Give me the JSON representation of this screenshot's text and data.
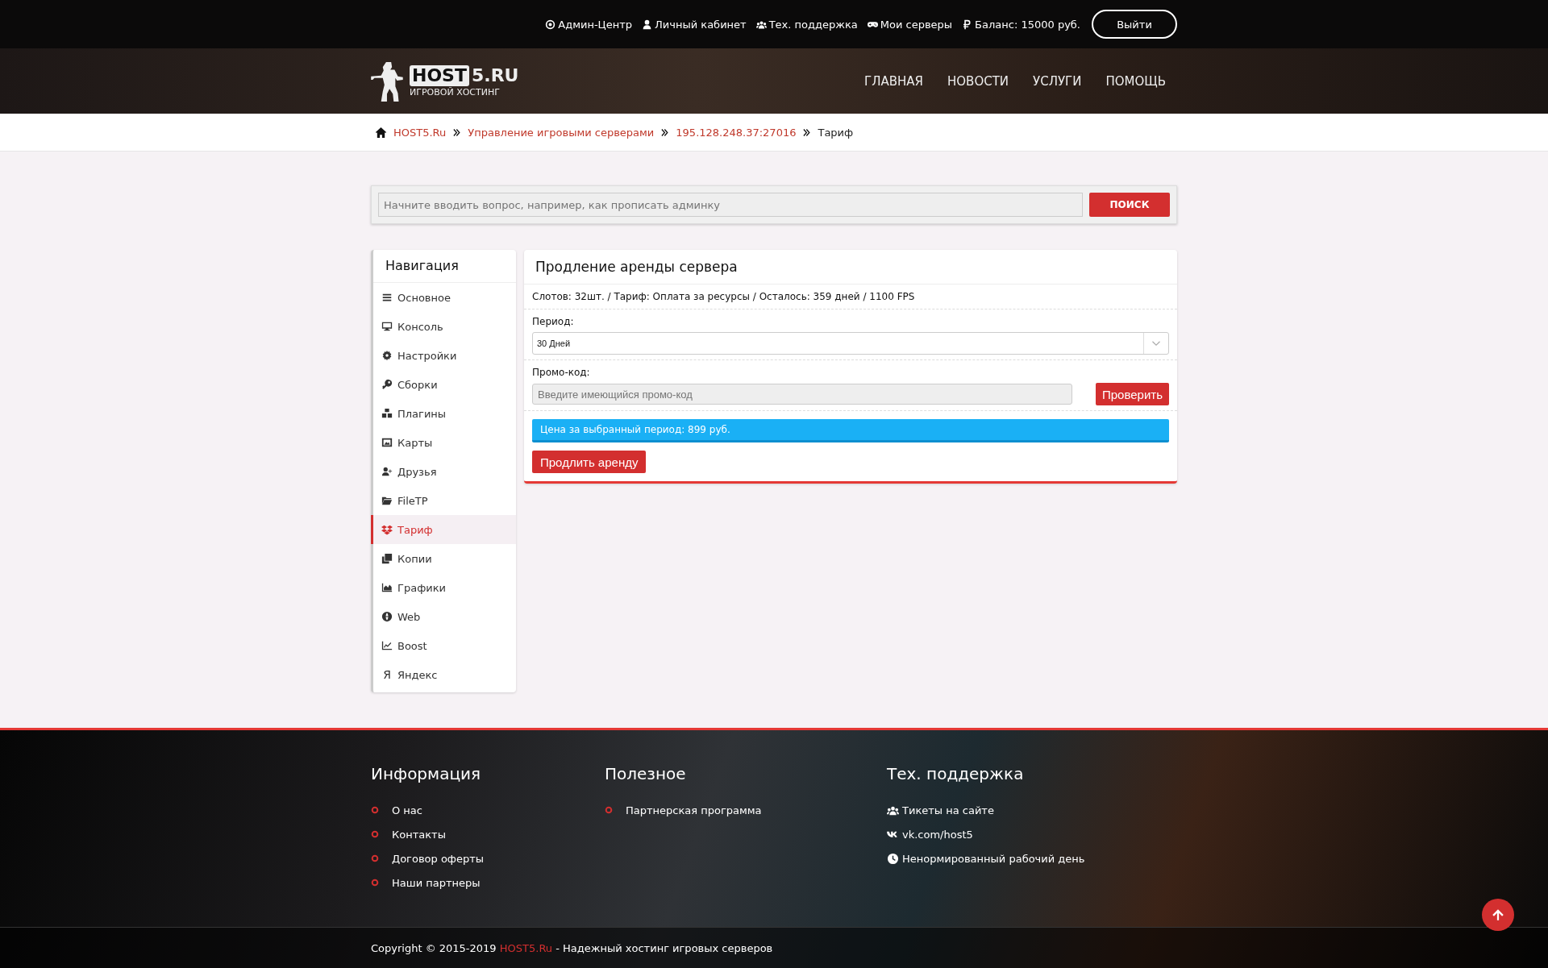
{
  "top_bar": {
    "links": [
      {
        "label": "Админ-Центр"
      },
      {
        "label": "Личный кабинет"
      },
      {
        "label": "Тех. поддержка"
      },
      {
        "label": "Мои серверы"
      },
      {
        "label": "Баланс: 15000 руб."
      }
    ],
    "logout": "Выйти"
  },
  "header": {
    "logo": {
      "boxed": "HOST",
      "rest": "5.RU",
      "tagline": "ИГРОВОЙ ХОСТИНГ"
    },
    "nav": [
      "ГЛАВНАЯ",
      "НОВОСТИ",
      "УСЛУГИ",
      "ПОМОЩЬ"
    ]
  },
  "breadcrumb": [
    {
      "label": "HOST5.Ru",
      "current": false
    },
    {
      "label": "Управление игровыми серверами",
      "current": false
    },
    {
      "label": "195.128.248.37:27016",
      "current": false
    },
    {
      "label": "Тариф",
      "current": true
    }
  ],
  "search": {
    "placeholder": "Начните вводить вопрос, например, как прописать админку",
    "button": "ПОИСК"
  },
  "sidebar": {
    "title": "Навигация",
    "items": [
      {
        "label": "Основное",
        "selected": false
      },
      {
        "label": "Консоль",
        "selected": false
      },
      {
        "label": "Настройки",
        "selected": false
      },
      {
        "label": "Сборки",
        "selected": false
      },
      {
        "label": "Плагины",
        "selected": false
      },
      {
        "label": "Карты",
        "selected": false
      },
      {
        "label": "Друзья",
        "selected": false
      },
      {
        "label": "FileTP",
        "selected": false
      },
      {
        "label": "Тариф",
        "selected": true
      },
      {
        "label": "Копии",
        "selected": false
      },
      {
        "label": "Графики",
        "selected": false
      },
      {
        "label": "Web",
        "selected": false
      },
      {
        "label": "Boost",
        "selected": false
      },
      {
        "label": "Яндекс",
        "selected": false,
        "glyph": "Я"
      }
    ]
  },
  "panel": {
    "title": "Продление аренды сервера",
    "info": "Слотов: 32шт. / Тариф: Оплата за ресурсы / Осталось: 359 дней / 1100 FPS",
    "period": {
      "label": "Период:",
      "value": "30 Дней"
    },
    "promo": {
      "label": "Промо-код:",
      "placeholder": "Введите имеющийся промо-код",
      "button": "Проверить"
    },
    "price": "Цена за выбранный период: 899 руб.",
    "submit": "Продлить аренду"
  },
  "footer": {
    "columns": [
      {
        "title": "Информация",
        "kind": "bullets",
        "links": [
          "О нас",
          "Контакты",
          "Договор оферты",
          "Наши партнеры"
        ]
      },
      {
        "title": "Полезное",
        "kind": "bullets",
        "links": [
          "Партнерская программа"
        ]
      },
      {
        "title": "Тех. поддержка",
        "kind": "icons",
        "links": [
          "Тикеты на сайте",
          "vk.com/host5",
          "Ненормированный рабочий день"
        ]
      }
    ],
    "copyright": {
      "prefix": "Copyright © 2015-2019",
      "brand": "HOST5.Ru",
      "suffix": "- Надежный хостинг игровых серверов"
    }
  }
}
